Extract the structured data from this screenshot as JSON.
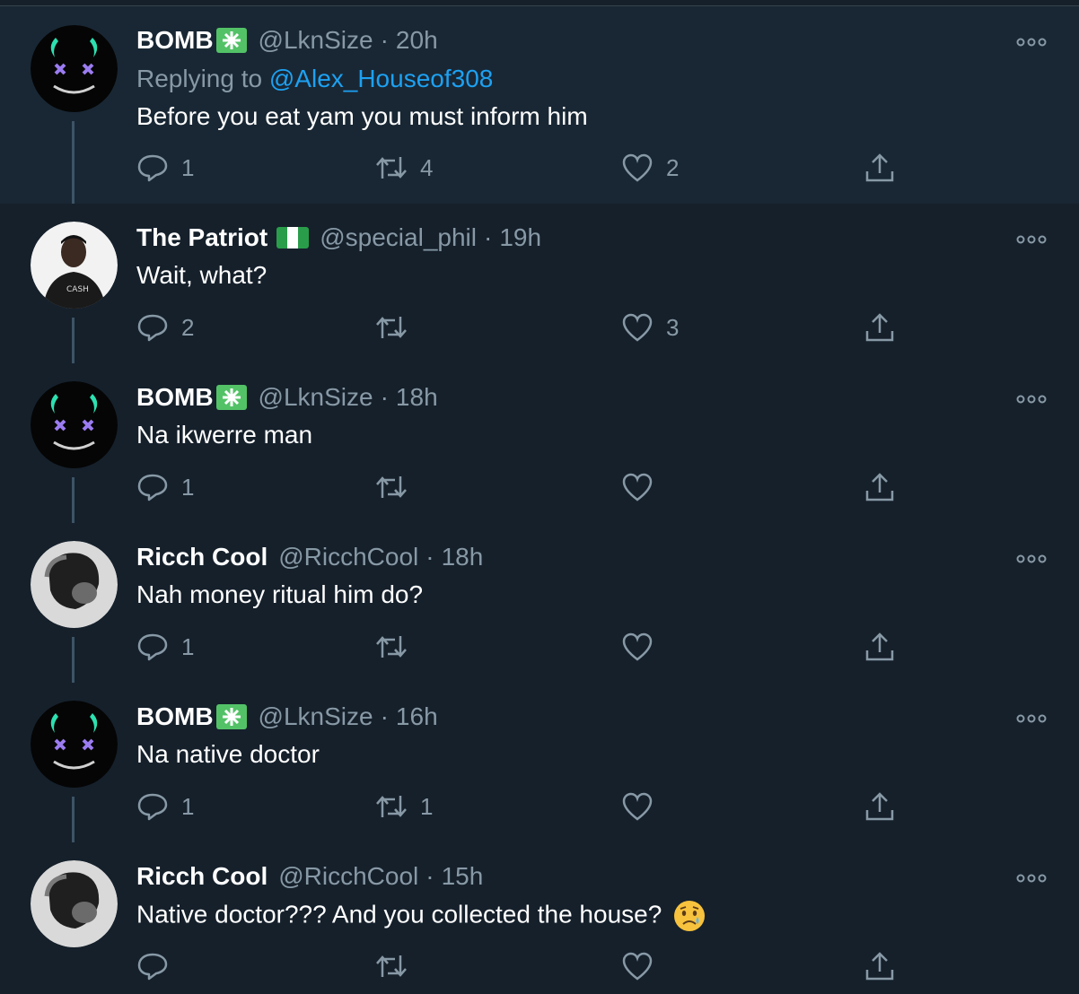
{
  "tweets": [
    {
      "name": "BOMB",
      "handle": "@LknSize",
      "dot": "·",
      "time": "20h",
      "replying_prefix": "Replying to",
      "replying_to": "@Alex_Houseof308",
      "text": "Before you eat yam you must inform him",
      "replies": "1",
      "retweets": "4",
      "likes": "2"
    },
    {
      "name": "The Patriot",
      "handle": "@special_phil",
      "dot": "·",
      "time": "19h",
      "text": "Wait, what?",
      "avatar_shirt_text": "CASH",
      "replies": "2",
      "retweets": "",
      "likes": "3"
    },
    {
      "name": "BOMB",
      "handle": "@LknSize",
      "dot": "·",
      "time": "18h",
      "text": "Na ikwerre man",
      "replies": "1",
      "retweets": "",
      "likes": ""
    },
    {
      "name": "Ricch Cool",
      "handle": "@RicchCool",
      "dot": "·",
      "time": "18h",
      "text": "Nah money ritual him do?",
      "replies": "1",
      "retweets": "",
      "likes": ""
    },
    {
      "name": "BOMB",
      "handle": "@LknSize",
      "dot": "·",
      "time": "16h",
      "text": "Na native doctor",
      "replies": "1",
      "retweets": "1",
      "likes": ""
    },
    {
      "name": "Ricch Cool",
      "handle": "@RicchCool",
      "dot": "·",
      "time": "15h",
      "text": "Native doctor??? And you collected the house?",
      "replies": "",
      "retweets": "",
      "likes": ""
    }
  ],
  "icons": {
    "reply": "reply-icon",
    "retweet": "retweet-icon",
    "like": "heart-icon",
    "share": "share-icon",
    "more": "more-icon",
    "verified_like_badge": "green-asterisk-badge",
    "flag": "nigeria-flag-icon",
    "emoji": "crying-face-emoji"
  },
  "colors": {
    "background": "#15202b",
    "highlight_background": "#192734",
    "secondary_text": "#8899a6",
    "link": "#1da1f2",
    "badge_green": "#53c267"
  }
}
